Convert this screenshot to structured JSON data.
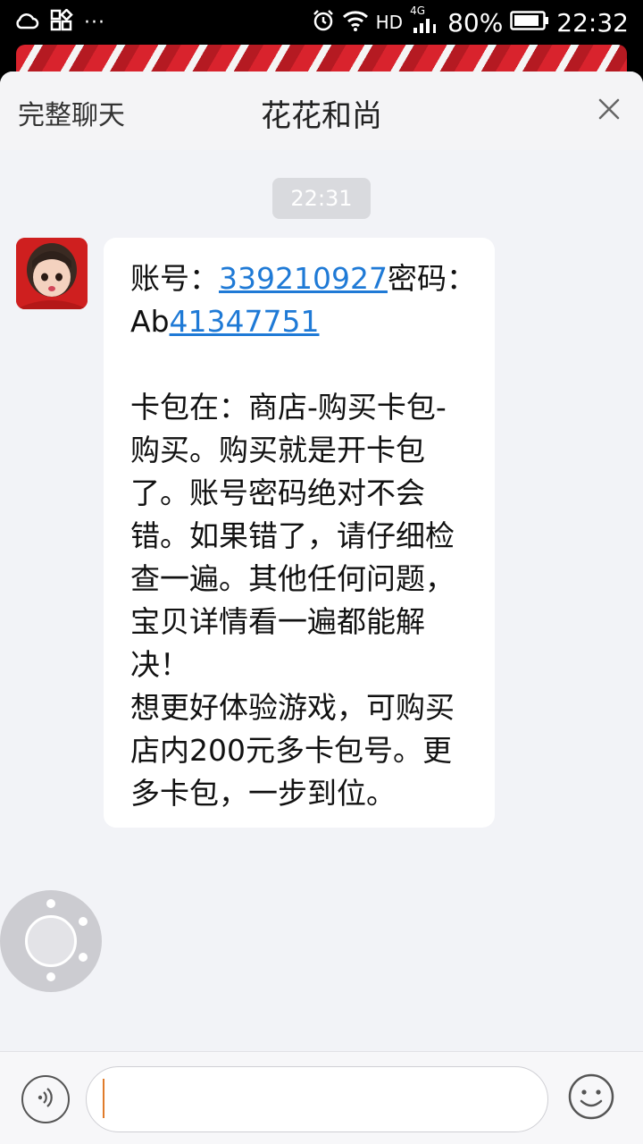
{
  "status_bar": {
    "dots": "···",
    "hd": "HD",
    "network": "4G",
    "battery": "80%",
    "time": "22:32"
  },
  "header": {
    "full_chat_label": "完整聊天",
    "title": "花花和尚",
    "close_icon": "close-icon"
  },
  "chat": {
    "timestamp": "22:31",
    "message": {
      "account_label": "账号：",
      "account_value": "339210927",
      "password_label": "密码：",
      "password_prefix": "Ab",
      "password_digits": "41347751",
      "lines": [
        "卡包在：商店-购买卡包-",
        "购买。购买就是开卡包",
        "了。账号密码绝对不会",
        "错。如果错了，请仔细检",
        "查一遍。其他任何问题，",
        "宝贝详情看一遍都能解",
        "决！",
        "想更好体验游戏，可购买",
        "店内200元多卡包号。更",
        "多卡包，一步到位。"
      ]
    }
  },
  "input_bar": {
    "value": "",
    "voice_icon": "voice-icon",
    "emoji_icon": "emoji-icon"
  },
  "colors": {
    "link": "#1f7ad6",
    "panel_bg": "#f2f3f7",
    "bubble_bg": "#ffffff",
    "caret": "#e07b2a"
  }
}
